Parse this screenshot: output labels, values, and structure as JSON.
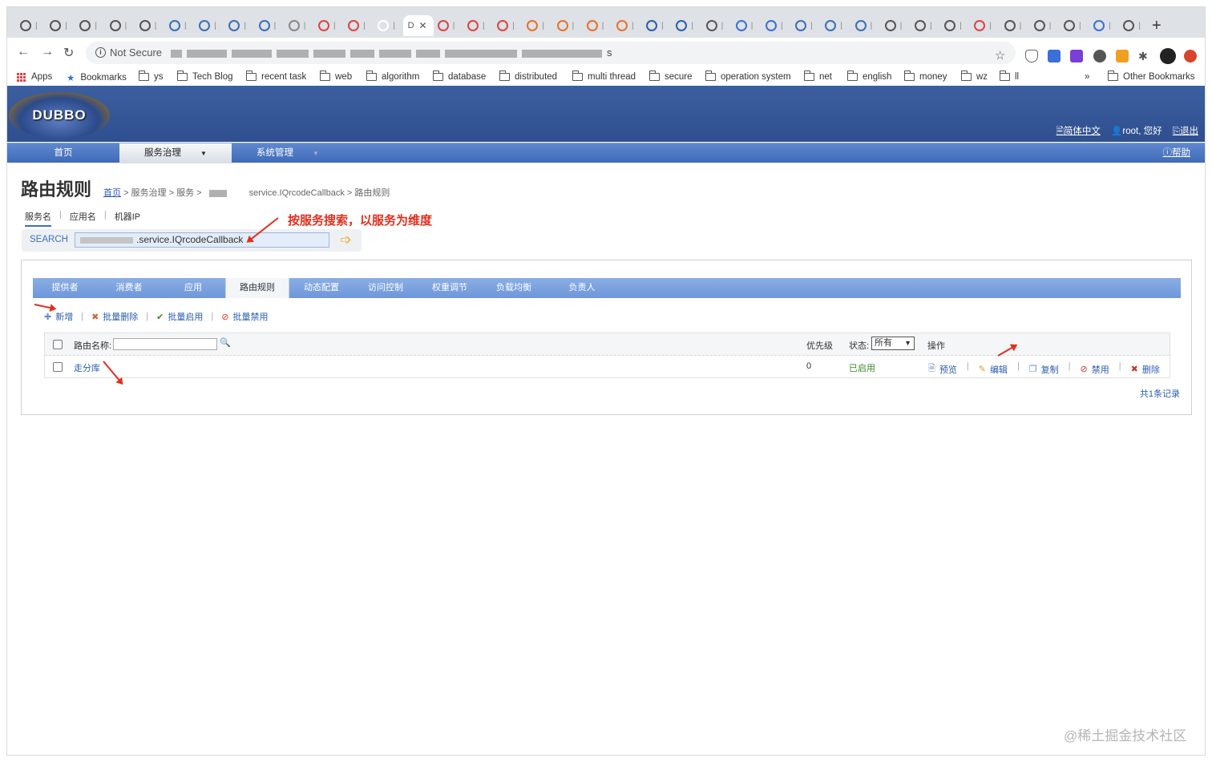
{
  "browser": {
    "tabs": [
      "",
      "",
      "",
      "",
      "",
      "",
      "",
      "",
      "",
      "",
      "",
      "",
      "",
      "D",
      "",
      "",
      "",
      "",
      "",
      "",
      "",
      "",
      "",
      "",
      "",
      "",
      "",
      "",
      "",
      "",
      "",
      "",
      "",
      "",
      "",
      "",
      "",
      ""
    ],
    "new_tab": "+",
    "security_label": "Not Secure",
    "url_suffix": "s",
    "bookmarks": [
      "Apps",
      "Bookmarks",
      "ys",
      "Tech Blog",
      "recent task",
      "web",
      "algorithm",
      "database",
      "distributed",
      "multi thread",
      "secure",
      "operation system",
      "net",
      "english",
      "money",
      "wz",
      "ll"
    ],
    "more": "»",
    "other_bookmarks": "Other Bookmarks"
  },
  "header": {
    "logo_text": "DUBBO",
    "lang": "简体中文",
    "user": "root, 您好",
    "logout": "退出"
  },
  "menu": {
    "items": [
      "首页",
      "服务治理",
      "系统管理"
    ],
    "help": "帮助"
  },
  "page": {
    "title": "路由规则",
    "breadcrumb": {
      "home": "首页",
      "path1": "> 服务治理 > 服务 >",
      "service": "service.IQrcodeCallback",
      "path2": "> 路由规则"
    },
    "search_tabs": [
      "服务名",
      "应用名",
      "机器IP"
    ],
    "search_label": "SEARCH",
    "search_value": ".service.IQrcodeCallback",
    "annotation": "按服务搜索，以服务为维度"
  },
  "panel": {
    "tabs": [
      "提供者",
      "消费者",
      "应用",
      "路由规则",
      "动态配置",
      "访问控制",
      "权重调节",
      "负载均衡",
      "负责人"
    ],
    "actions": [
      {
        "icon": "✚",
        "label": "新增"
      },
      {
        "icon": "✖",
        "label": "批量删除"
      },
      {
        "icon": "✔",
        "label": "批量启用"
      },
      {
        "icon": "⊘",
        "label": "批量禁用"
      }
    ],
    "table": {
      "route_name_label": "路由名称:",
      "priority_label": "优先级",
      "status_label": "状态:",
      "status_option": "所有",
      "ops_label": "操作",
      "rows": [
        {
          "name": "走分库",
          "priority": "0",
          "status": "已启用"
        }
      ],
      "row_ops": [
        {
          "icon": "🗎",
          "label": "预览"
        },
        {
          "icon": "✎",
          "label": "编辑"
        },
        {
          "icon": "❐",
          "label": "复制"
        },
        {
          "icon": "⊘",
          "label": "禁用"
        },
        {
          "icon": "✖",
          "label": "删除"
        }
      ]
    },
    "total": "共1条记录"
  },
  "watermark": "@稀土掘金技术社区",
  "colors": {
    "header_blue": "#3c5fa0",
    "menu_blue": "#4f7cc8",
    "link": "#2a5db0",
    "annotation_red": "#e0301e",
    "enabled_green": "#3a8a2a"
  }
}
